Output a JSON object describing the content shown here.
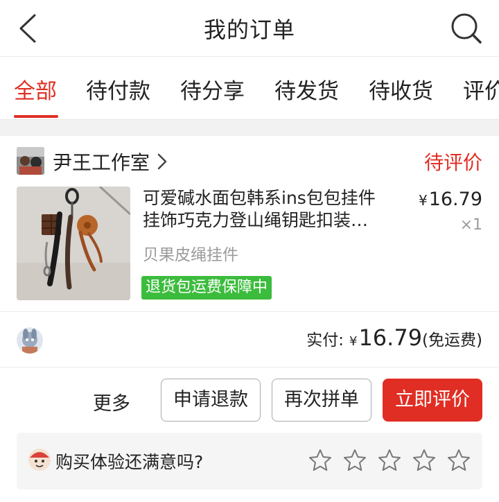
{
  "header": {
    "title": "我的订单",
    "back_icon": "chevron-left-icon",
    "search_icon": "search-icon"
  },
  "tabs": [
    {
      "label": "全部",
      "active": true
    },
    {
      "label": "待付款",
      "active": false
    },
    {
      "label": "待分享",
      "active": false
    },
    {
      "label": "待发货",
      "active": false
    },
    {
      "label": "待收货",
      "active": false
    },
    {
      "label": "评价",
      "active": false
    }
  ],
  "order": {
    "shop_name": "尹王工作室",
    "status": "待评价",
    "product": {
      "title_line1": "可爱碱水面包韩系ins包包挂件",
      "title_line2": "挂饰巧克力登山绳钥匙扣装…",
      "spec": "贝果皮绳挂件",
      "badge": "退货包运费保障中",
      "currency": "¥",
      "price": "16.79",
      "quantity": "×1"
    },
    "payment": {
      "label": "实付:",
      "currency": "¥",
      "amount": "16.79",
      "shipping_note": "(免运费)"
    },
    "actions": {
      "more": "更多",
      "refund": "申请退款",
      "reorder": "再次拼单",
      "review": "立即评价"
    },
    "survey": {
      "question": "购买体验还满意吗?",
      "stars": 5,
      "rating": 0
    }
  },
  "colors": {
    "accent": "#e02e24",
    "badge_green": "#3cbc3d",
    "muted_text": "#9b9b9b"
  }
}
